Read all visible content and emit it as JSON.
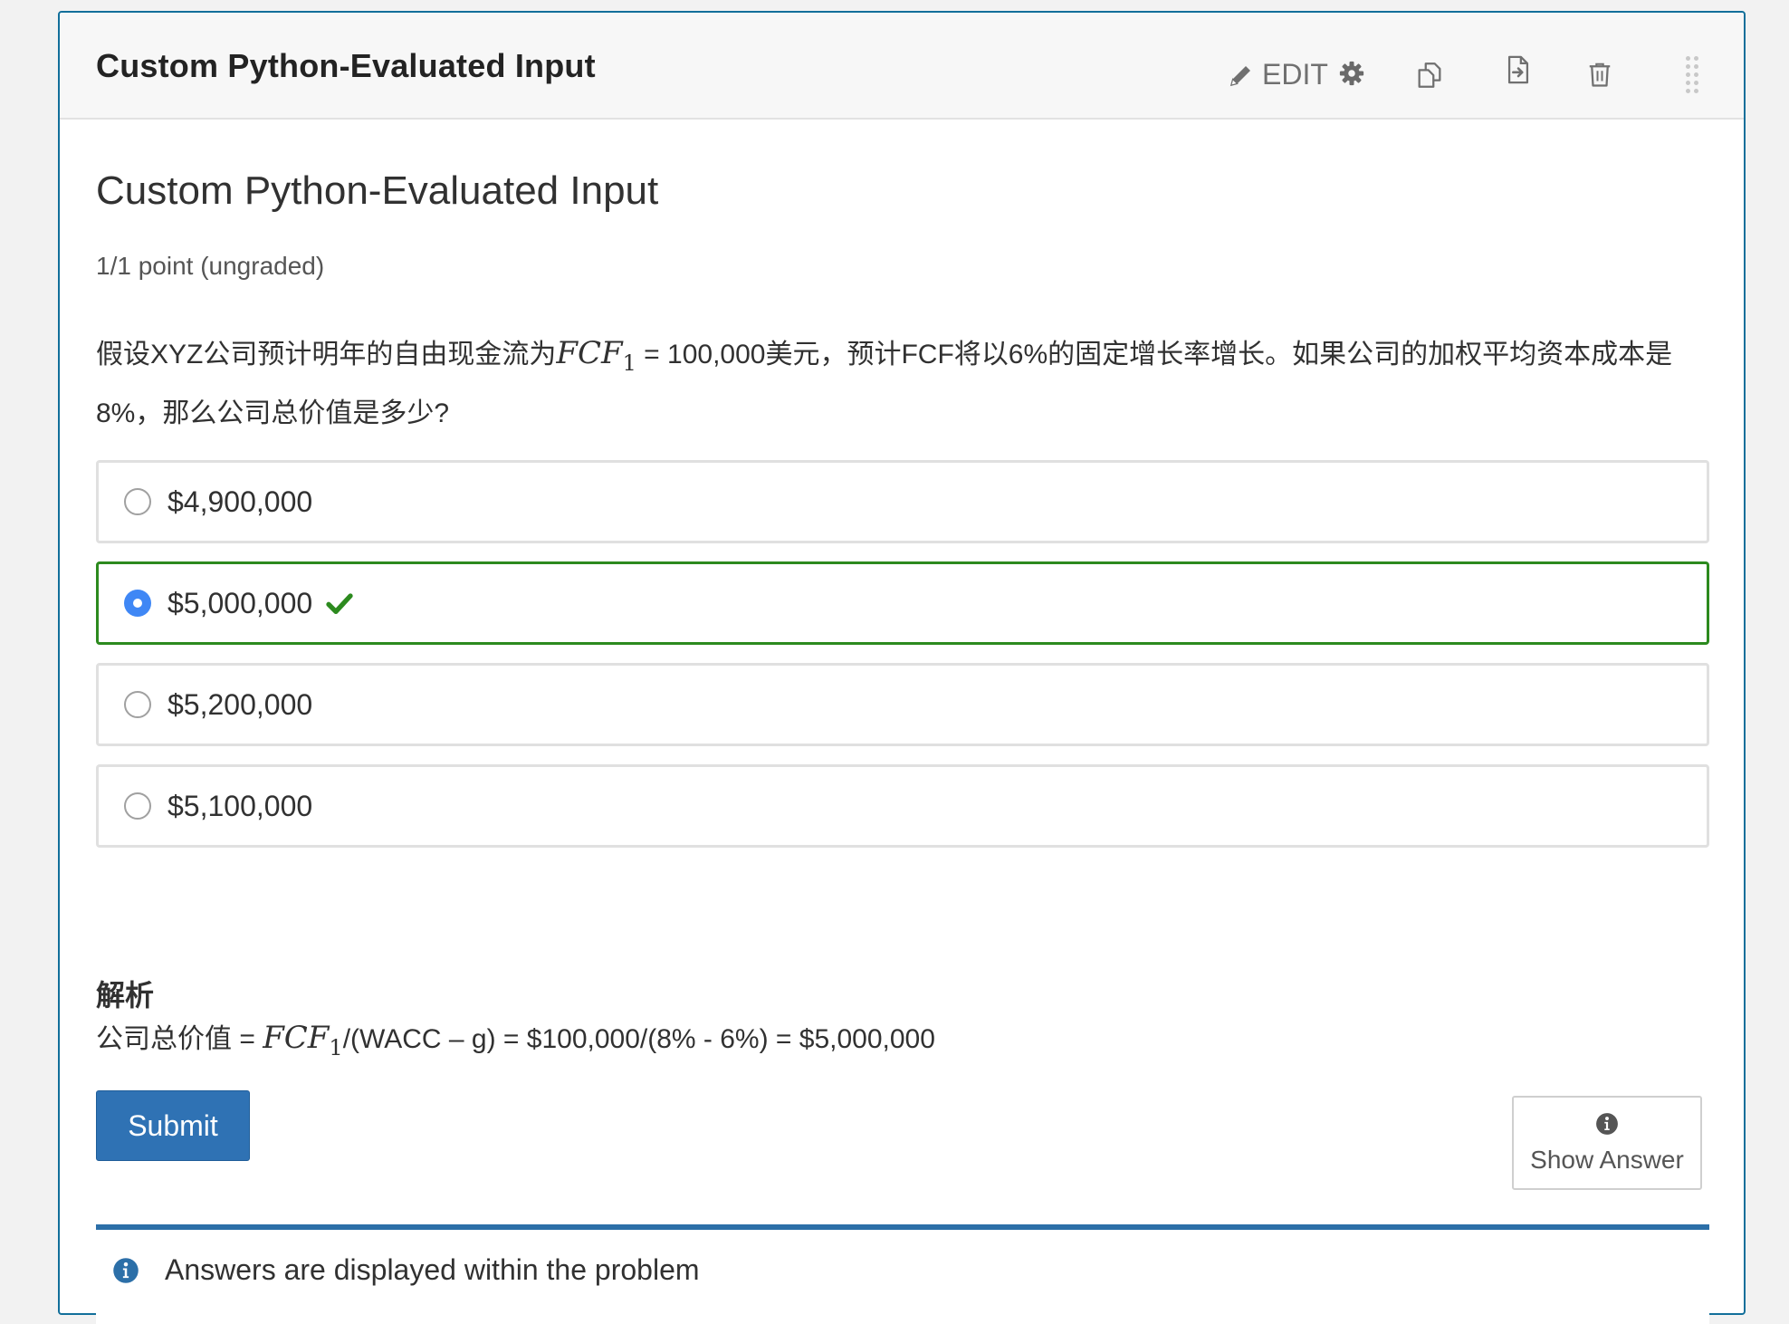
{
  "header": {
    "title": "Custom Python-Evaluated Input",
    "edit_label": "EDIT"
  },
  "problem": {
    "title": "Custom Python-Evaluated Input",
    "progress": "1/1 point (ungraded)",
    "question_prefix": "假设XYZ公司预计明年的自由现金流为",
    "question_math": "FCF",
    "question_math_sub": "1",
    "question_suffix": " = 100,000美元，预计FCF将以6%的固定增长率增长。如果公司的加权平均资本成本是8%，那么公司总价值是多少?"
  },
  "choices": [
    {
      "label": "$4,900,000",
      "selected": false,
      "correct": false
    },
    {
      "label": "$5,000,000",
      "selected": true,
      "correct": true
    },
    {
      "label": "$5,200,000",
      "selected": false,
      "correct": false
    },
    {
      "label": "$5,100,000",
      "selected": false,
      "correct": false
    }
  ],
  "solution": {
    "heading": "解析",
    "prefix": "公司总价值 = ",
    "math": "FCF",
    "math_sub": "1",
    "suffix": "/(WACC – g) = $100,000/(8% - 6%) = $5,000,000"
  },
  "actions": {
    "submit_label": "Submit",
    "show_answer_label": "Show Answer"
  },
  "notification": {
    "text": "Answers are displayed within the problem"
  },
  "colors": {
    "accent_blue": "#2f72b4",
    "card_border": "#126f9a",
    "correct_green": "#2c8a1e",
    "radio_selected": "#3f87f5"
  },
  "icons": {
    "edit": "pencil-icon",
    "settings": "gear-icon",
    "duplicate": "duplicate-icon",
    "move": "move-icon",
    "delete": "trash-icon",
    "drag": "drag-handle-icon",
    "correct": "checkmark-icon",
    "info": "info-icon"
  }
}
